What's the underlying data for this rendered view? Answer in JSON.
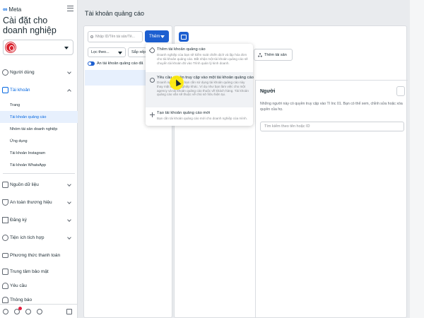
{
  "sidebar": {
    "logo_text": "Meta",
    "title": "Cài đặt cho doanh nghiệp",
    "sections": [
      {
        "label": "Người dùng"
      },
      {
        "label": "Tài khoản"
      },
      {
        "label": "Nguồn dữ liệu"
      },
      {
        "label": "An toàn thương hiệu"
      },
      {
        "label": "Đăng ký"
      },
      {
        "label": "Tiện ích tích hợp"
      },
      {
        "label": "Phương thức thanh toán"
      },
      {
        "label": "Trung tâm bảo mật"
      },
      {
        "label": "Yêu cầu"
      },
      {
        "label": "Thông báo"
      }
    ],
    "account_sub_items": [
      {
        "label": "Trang"
      },
      {
        "label": "Tài khoản quảng cáo"
      },
      {
        "label": "Nhóm tài sản doanh nghiệp"
      },
      {
        "label": "Ứng dụng"
      },
      {
        "label": "Tài khoản Instagram"
      },
      {
        "label": "Tài khoản WhatsApp"
      }
    ]
  },
  "main": {
    "page_title": "Tài khoản quảng cáo",
    "search_placeholder": "Nhập ID/Tên tài sản/Tê...",
    "add_button": "Thêm",
    "filter_label": "Lọc theo...",
    "sort_label": "Sắp xếp",
    "hide_toggle_label": "Ẩn tài khoản quảng cáo đã"
  },
  "detail": {
    "add_asset_button": "Thêm tài sản",
    "people_title": "Người",
    "people_desc": "Những người này có quyền truy cập vào TI Inc 01. Bạn có thể xem, chỉnh sửa hoặc xóa quyền của họ.",
    "people_search_placeholder": "Tìm kiếm theo tên hoặc ID"
  },
  "dropdown": {
    "items": [
      {
        "title": "Thêm tài khoản quảng cáo",
        "desc": "Doanh nghiệp của bạn sẽ kiểm soát chiến dịch và lập hóa đơn cho tài khoản quảng cáo. Bắt nhận một tài khoản quảng cáo sẽ chuyển tài khoản đó vào Trình quản lý kinh doanh."
      },
      {
        "title": "Yêu cầu quyền truy cập vào một tài khoản quảng cáo",
        "desc": "Doanh nghiệp của bạn cần sử dụng tài khoản quảng cáo này thay mặt doanh nghiệp khác. Ví dụ như bạn làm việc cho một agency và tài khoản quảng cáo thuộc về khách hàng. Tài khoản quảng cáo vẫn sẽ thuộc về chủ sở hữu hiện tại."
      },
      {
        "title": "Tạo tài khoản quảng cáo mới",
        "desc": "Bạn cần tài khoản quảng cáo mới cho doanh nghiệp của mình."
      }
    ]
  },
  "colors": {
    "accent": "#1d5fd0",
    "highlight": "#e7f0fd",
    "cursor": "#ffeb00"
  }
}
